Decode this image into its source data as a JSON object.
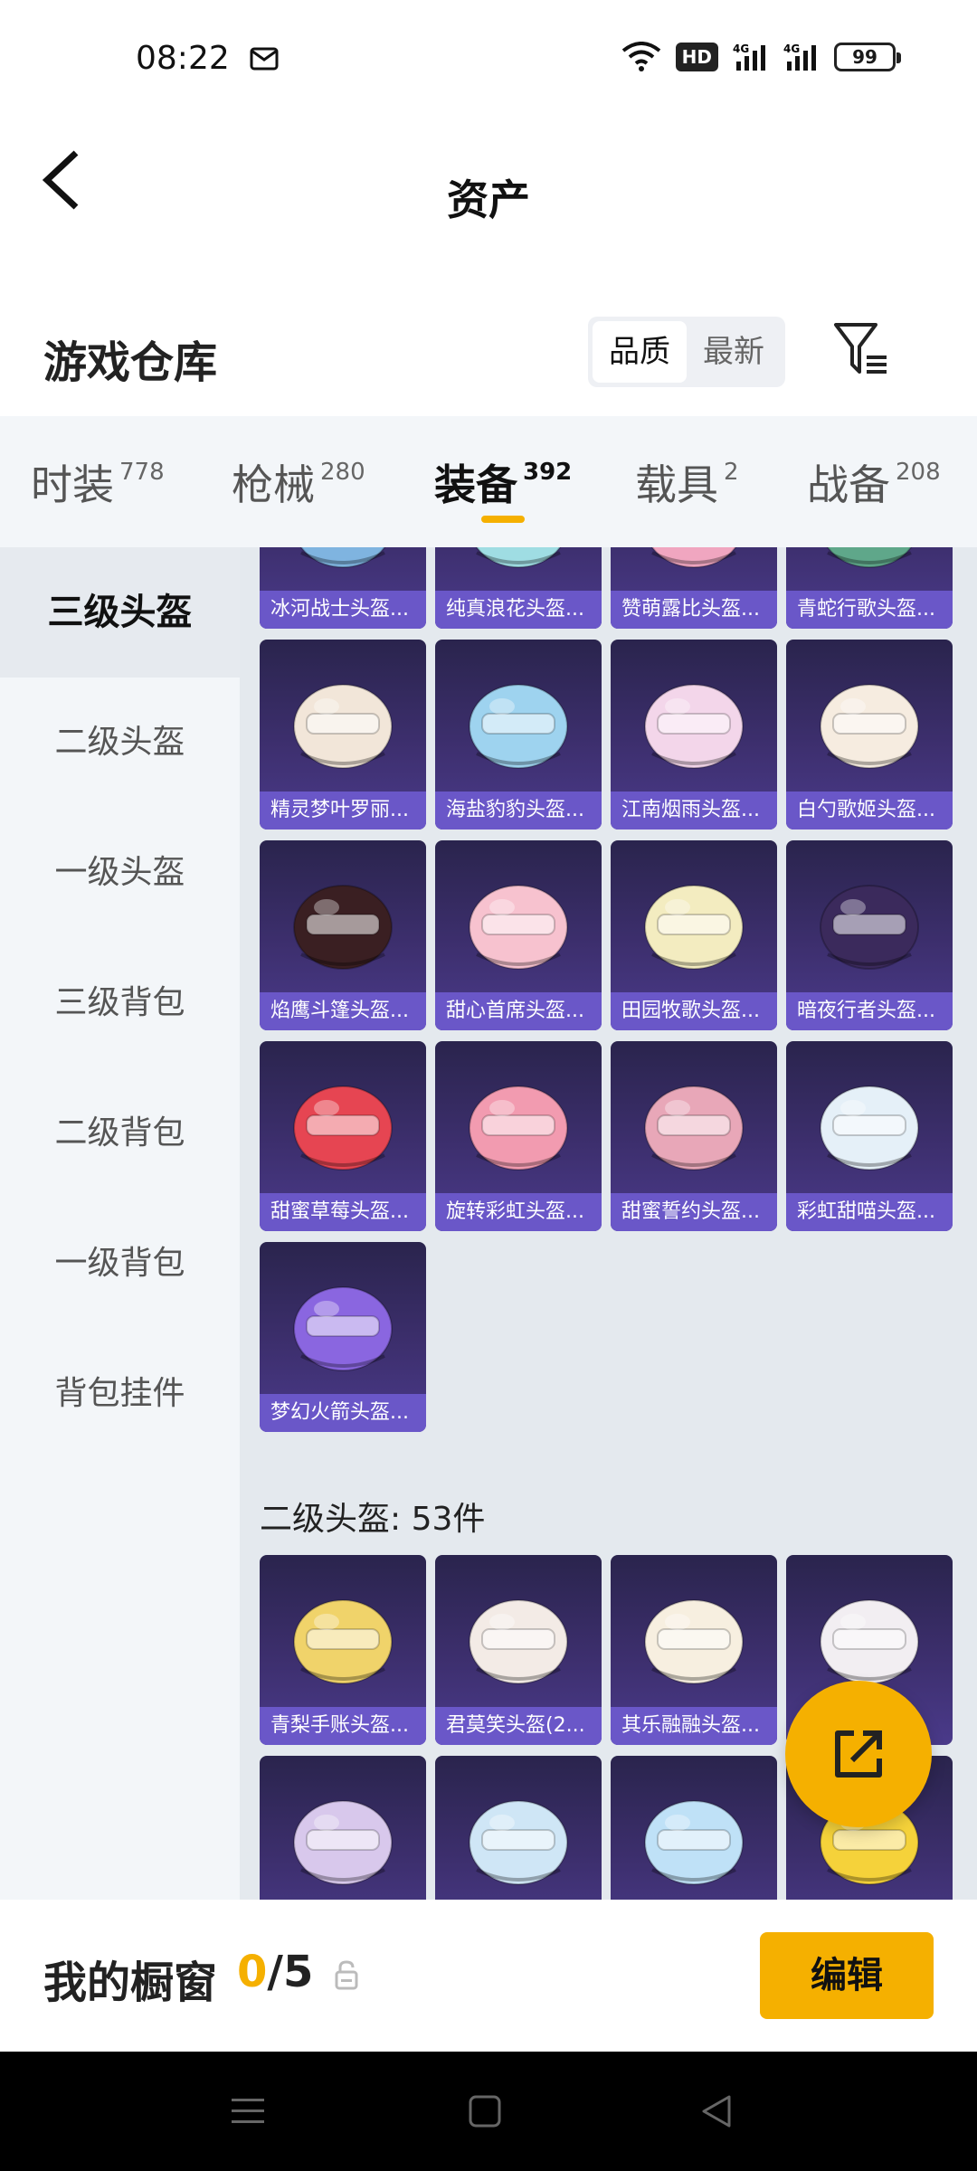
{
  "status": {
    "time": "08:22",
    "hd": "HD",
    "battery": "99"
  },
  "header": {
    "title": "资产"
  },
  "section": {
    "title": "游戏仓库",
    "sort_options": [
      "品质",
      "最新"
    ],
    "sort_active": "品质"
  },
  "tabs": [
    {
      "label": "时装",
      "count": "778"
    },
    {
      "label": "枪械",
      "count": "280"
    },
    {
      "label": "装备",
      "count": "392"
    },
    {
      "label": "载具",
      "count": "2"
    },
    {
      "label": "战备",
      "count": "208"
    }
  ],
  "sidebar": {
    "items": [
      "三级头盔",
      "二级头盔",
      "一级头盔",
      "三级背包",
      "二级背包",
      "一级背包",
      "背包挂件"
    ]
  },
  "grid_top": [
    {
      "label": "冰河战士头盔...",
      "color": "#7fb4e0"
    },
    {
      "label": "纯真浪花头盔...",
      "color": "#9fdde3"
    },
    {
      "label": "赞萌露比头盔...",
      "color": "#f0a6c0"
    },
    {
      "label": "青蛇行歌头盔...",
      "color": "#5fa78a"
    },
    {
      "label": "精灵梦叶罗丽...",
      "color": "#f2e6d9"
    },
    {
      "label": "海盐豹豹头盔...",
      "color": "#9ed3ef"
    },
    {
      "label": "江南烟雨头盔...",
      "color": "#f3d6ea"
    },
    {
      "label": "白勺歌姬头盔...",
      "color": "#f6ece0"
    },
    {
      "label": "焰鹰斗篷头盔...",
      "color": "#3a1f22"
    },
    {
      "label": "甜心首席头盔...",
      "color": "#f7c2cf"
    },
    {
      "label": "田园牧歌头盔...",
      "color": "#f3ecc0"
    },
    {
      "label": "暗夜行者头盔...",
      "color": "#3b2a5c"
    },
    {
      "label": "甜蜜草莓头盔...",
      "color": "#e64552"
    },
    {
      "label": "旋转彩虹头盔...",
      "color": "#f29bb0"
    },
    {
      "label": "甜蜜誓约头盔...",
      "color": "#e8a7b8"
    },
    {
      "label": "彩虹甜喵头盔...",
      "color": "#e5f0f8"
    },
    {
      "label": "梦幻火箭头盔...",
      "color": "#8a66e0"
    }
  ],
  "subsection": {
    "label": "二级头盔: 53件"
  },
  "grid_bottom": [
    {
      "label": "青梨手账头盔...",
      "color": "#f0d36a"
    },
    {
      "label": "君莫笑头盔(2...",
      "color": "#f3ebe6"
    },
    {
      "label": "其乐融融头盔...",
      "color": "#f7efe0"
    },
    {
      "label": "",
      "color": "#f2eef2"
    },
    {
      "label": "",
      "color": "#d8c8ec"
    },
    {
      "label": "",
      "color": "#cfe6f6"
    },
    {
      "label": "",
      "color": "#bfe1f7"
    },
    {
      "label": "",
      "color": "#f5d23a"
    }
  ],
  "showcase": {
    "title": "我的橱窗",
    "current": "0",
    "separator": "/",
    "total": "5",
    "edit_label": "编辑"
  },
  "colors": {
    "accent": "#f5b000",
    "card_label_bg": "#6a57c8"
  }
}
